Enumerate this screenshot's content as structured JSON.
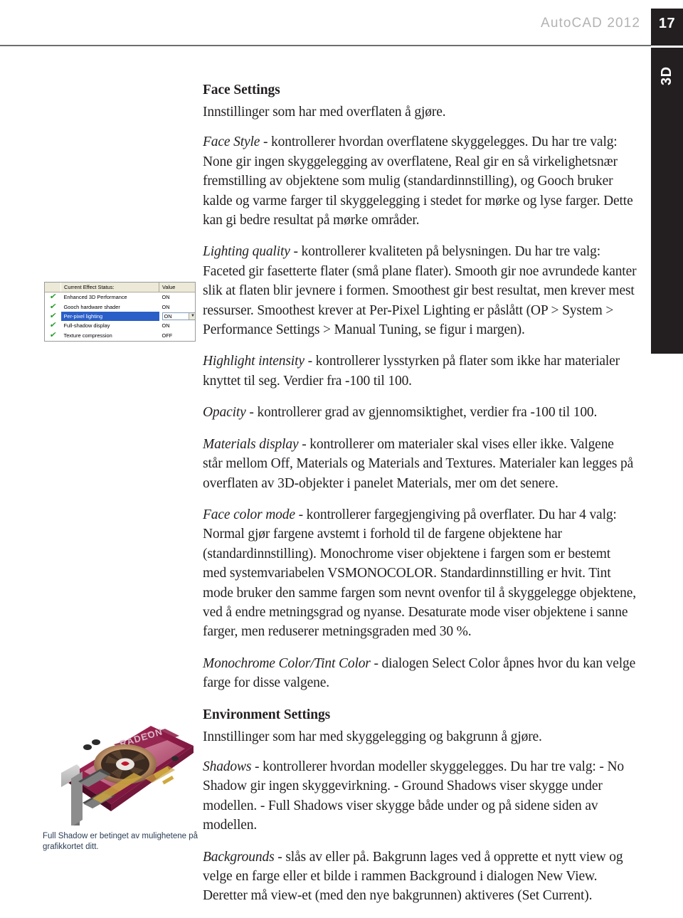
{
  "header": {
    "title": "AutoCAD 2012",
    "page_number": "17",
    "section_tab": "3D"
  },
  "content": {
    "face_settings_heading": "Face Settings",
    "face_settings_intro": "Innstillinger som har med overflaten å gjøre.",
    "face_style": {
      "term": "Face Style",
      "body": " - kontrollerer hvordan overflatene skyggelegges. Du har tre valg: None gir ingen skyggelegging av overflatene, Real gir en så virkelighetsnær fremstilling av objektene som mulig (standardinnstilling), og Gooch bruker kalde og varme farger til skyggelegging i stedet for mørke og lyse farger. Dette kan gi bedre resultat på mørke områder."
    },
    "lighting_quality": {
      "term": "Lighting quality",
      "body": " - kontrollerer kvaliteten på belysningen. Du har tre valg: Faceted gir fasetterte flater (små plane flater). Smooth gir noe avrundede kanter slik at flaten blir jevnere i formen. Smoothest gir best resultat, men krever mest ressurser. Smoothest krever at Per-Pixel Lighting er påslått (OP > System > Performance Settings > Manual Tuning, se figur i margen)."
    },
    "highlight_intensity": {
      "term": "Highlight intensity",
      "body": " - kontrollerer lysstyrken på flater som ikke har materialer knyttet til seg. Verdier fra -100 til 100."
    },
    "opacity": {
      "term": "Opacity",
      "body": " - kontrollerer grad av gjennomsiktighet, verdier fra -100 til 100."
    },
    "materials_display": {
      "term": "Materials display",
      "body": " - kontrollerer om materialer skal vises eller ikke. Valgene står mellom Off, Materials og Materials and Textures. Materialer kan legges på overflaten av 3D-objekter i panelet Materials, mer om det senere."
    },
    "face_color_mode": {
      "term": "Face color mode",
      "body": " - kontrollerer fargegjengiving på overflater. Du har 4 valg: Normal gjør fargene avstemt i forhold til de fargene objektene har (standardinnstilling). Monochrome viser objektene i fargen som er bestemt med systemvariabelen VSMONOCOLOR. Standardinnstilling er hvit. Tint mode bruker den samme fargen som nevnt ovenfor til å skyggelegge objektene, ved å endre metningsgrad og nyanse. Desaturate mode viser objektene i sanne farger, men reduserer metningsgraden med 30 %."
    },
    "monochrome_color": {
      "term": "Monochrome Color/Tint Color",
      "body": " - dialogen Select Color åpnes hvor du kan velge farge for disse valgene."
    },
    "environment_settings_heading": "Environment Settings",
    "environment_settings_intro": "Innstillinger som har med skyggelegging og bakgrunn å gjøre.",
    "shadows": {
      "term": "Shadows",
      "body": " - kontrollerer hvordan modeller skyggelegges. Du har tre valg: - No Shadow gir ingen skyggevirkning. - Ground Shadows viser skygge under modellen. - Full Shadows viser skygge både under og på sidene siden av modellen."
    },
    "backgrounds": {
      "term": "Backgrounds",
      "body": " - slås av eller på. Bakgrunn lages ved å opprette et nytt view og velge en farge eller et bilde i rammen Background i dialogen New View. Deretter må view-et (med den nye bakgrunnen) aktiveres (Set Current)."
    }
  },
  "effect_status_figure": {
    "columns": [
      "",
      "Current Effect Status:",
      "Value"
    ],
    "rows": [
      {
        "check": "✔",
        "name": "Enhanced 3D Performance",
        "value": "ON",
        "selected": false,
        "combo": false
      },
      {
        "check": "✔",
        "name": "Gooch hardware shader",
        "value": "ON",
        "selected": false,
        "combo": false
      },
      {
        "check": "✔",
        "name": "Per-pixel lighting",
        "value": "ON",
        "selected": true,
        "combo": true
      },
      {
        "check": "✔",
        "name": "Full-shadow display",
        "value": "ON",
        "selected": false,
        "combo": false
      },
      {
        "check": "✔",
        "name": "Texture compression",
        "value": "OFF",
        "selected": false,
        "combo": false
      }
    ],
    "combo_arrow": "▼",
    "selection_color": "#2a5fc8",
    "check_color": "#1f9c22"
  },
  "gfx_card": {
    "caption": "Full Shadow er betinget av mulighetene på grafikkortet ditt.",
    "brand_text": "RADEON",
    "board_color": "#9e2050",
    "accent_color": "#c0456f"
  }
}
